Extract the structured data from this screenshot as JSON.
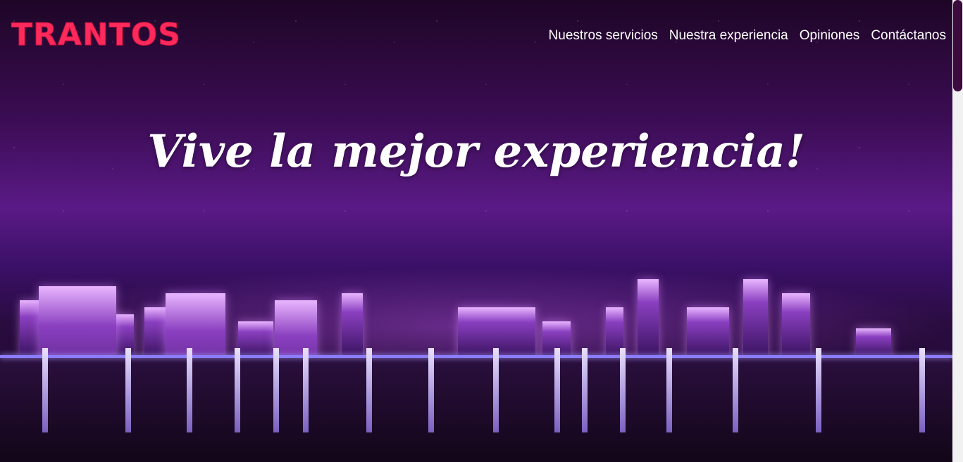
{
  "header": {
    "logo": "TRANTOS",
    "nav": [
      "Nuestros servicios",
      "Nuestra experiencia",
      "Opiniones",
      "Contáctanos"
    ]
  },
  "hero": {
    "title": "Vive la mejor experiencia!"
  },
  "colors": {
    "logo": "#ff2a5c",
    "scroll_thumb": "#3d0a3f"
  }
}
